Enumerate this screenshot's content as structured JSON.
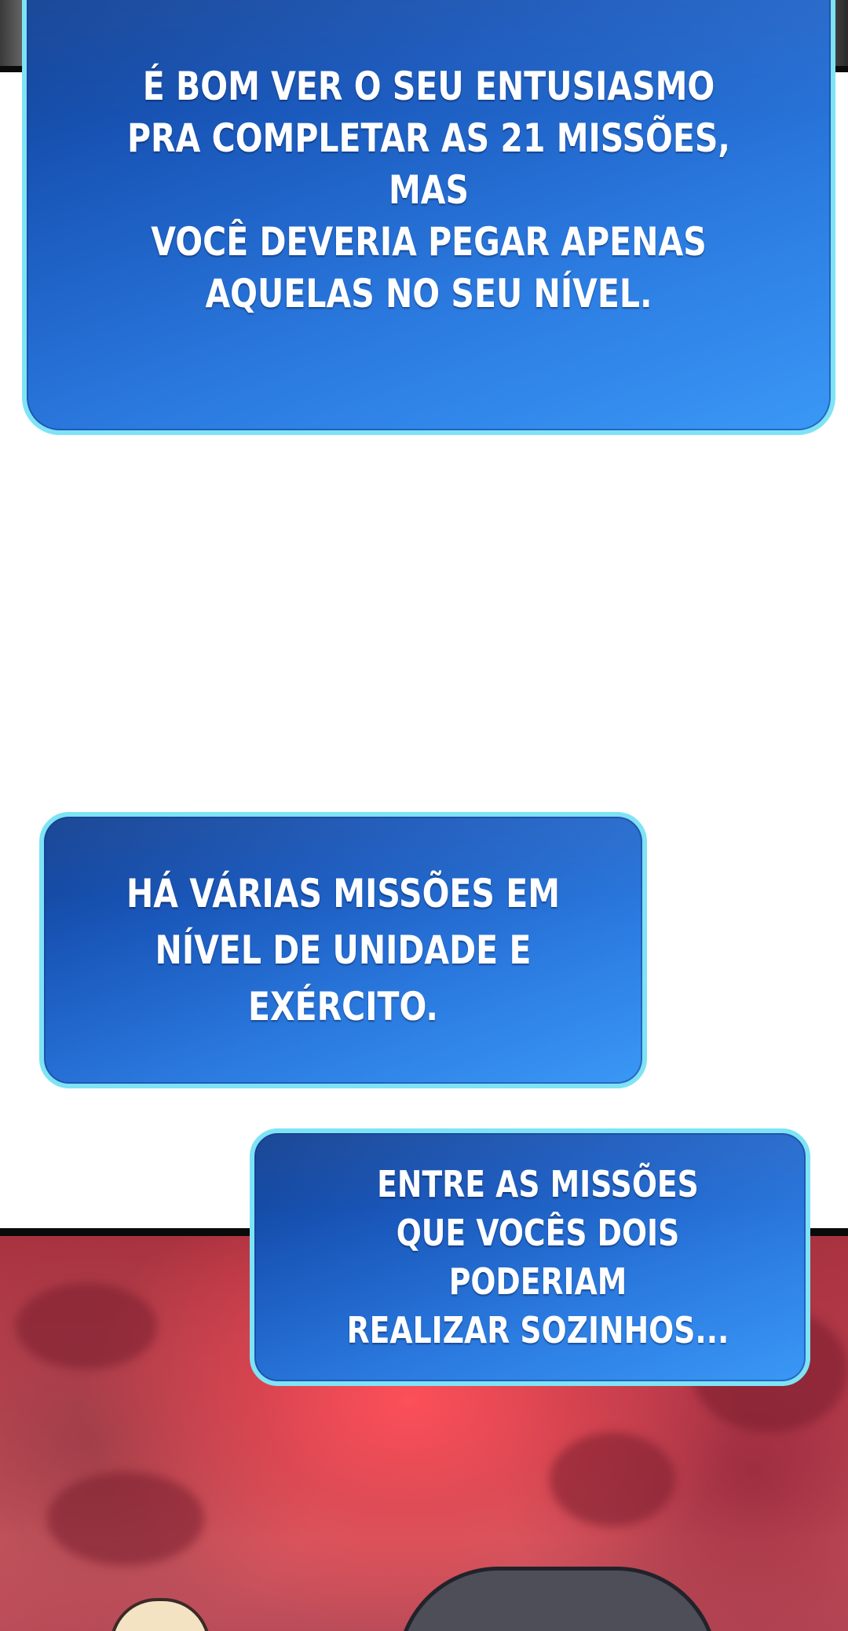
{
  "panels": [
    {
      "id": "panel-1",
      "text": "É BOM VER O SEU ENTUSIASMO\nPRA COMPLETAR AS 21 MISSÕES, MAS\nVOCÊ DEVERIA PEGAR APENAS\nAQUELAS NO SEU NÍVEL."
    },
    {
      "id": "panel-2",
      "text": "HÁ VÁRIAS MISSÕES EM\nNÍVEL DE UNIDADE E EXÉRCITO."
    },
    {
      "id": "panel-3",
      "text": "ENTRE AS MISSÕES\nQUE VOCÊS DOIS PODERIAM\nREALIZAR SOZINHOS..."
    }
  ],
  "colors": {
    "panel_border": "#7fe3f6",
    "panel_fill_top": "#0f3d8f",
    "panel_fill_bottom": "#3a98f6",
    "scene_red": "#c44452"
  }
}
